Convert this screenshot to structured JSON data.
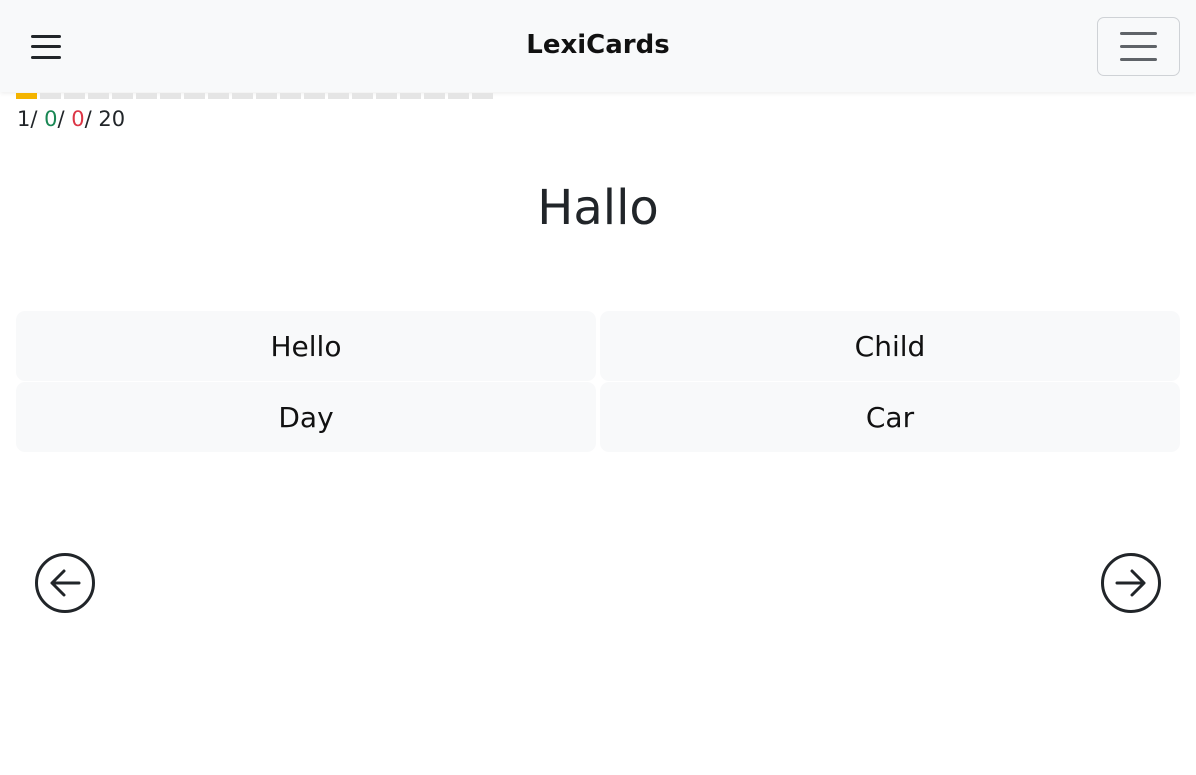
{
  "navbar": {
    "brand": "LexiCards",
    "menu_icon": "hamburger-icon",
    "toggler_icon": "hamburger-icon"
  },
  "progress": {
    "total_segments": 20,
    "current_index": 1,
    "current_color": "#f4b400",
    "empty_color": "#e5e5e5"
  },
  "counter": {
    "current": "1",
    "correct": "0",
    "wrong": "0",
    "total": "20",
    "correct_color": "#198754",
    "wrong_color": "#dc3545"
  },
  "card": {
    "word": "Hallo"
  },
  "options": [
    {
      "label": "Hello"
    },
    {
      "label": "Child"
    },
    {
      "label": "Day"
    },
    {
      "label": "Car"
    }
  ],
  "navigation": {
    "prev_icon": "arrow-left-circle-icon",
    "next_icon": "arrow-right-circle-icon"
  }
}
